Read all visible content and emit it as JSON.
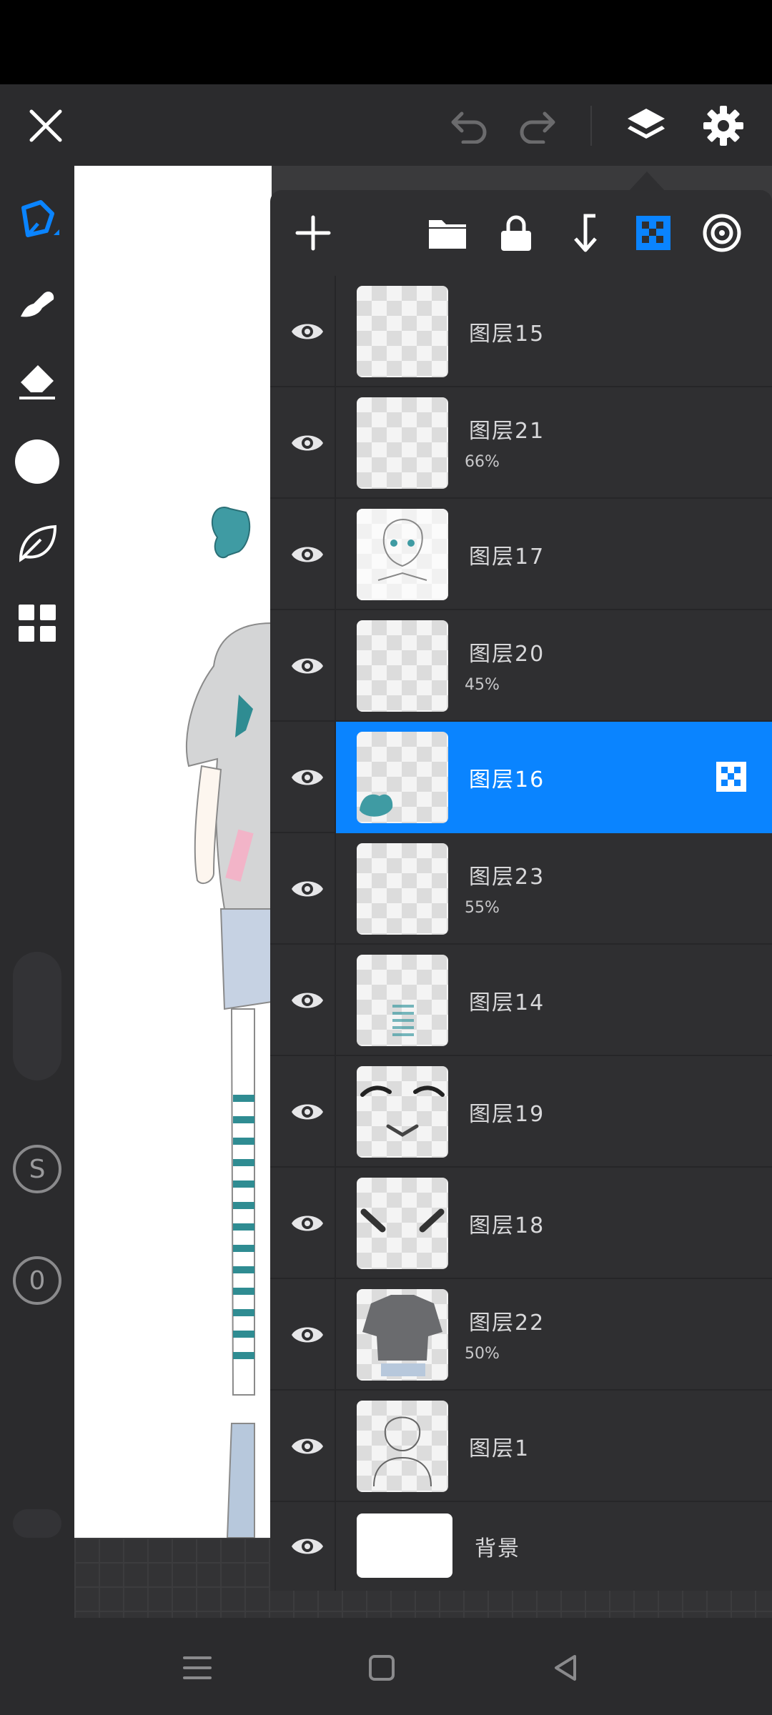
{
  "toolbar": {
    "close_icon": "close-icon",
    "undo_icon": "undo-icon",
    "redo_icon": "redo-icon",
    "layers_icon": "layers-icon",
    "settings_icon": "gear-icon"
  },
  "left_tools": [
    {
      "name": "pen-tool-icon",
      "active": true
    },
    {
      "name": "brush-tool-icon",
      "active": false
    },
    {
      "name": "eraser-tool-icon",
      "active": false
    },
    {
      "name": "color-swatch",
      "active": false
    },
    {
      "name": "leaf-tool-icon",
      "active": false
    },
    {
      "name": "grid-tool-icon",
      "active": false
    }
  ],
  "side_buttons": {
    "s_label": "S",
    "zero_label": "0"
  },
  "layer_panel": {
    "actions": [
      "add-layer-icon",
      "folder-icon",
      "lock-icon",
      "merge-down-icon",
      "alpha-lock-icon",
      "blend-icon"
    ],
    "accent_color": "#0a84ff",
    "layers": [
      {
        "name": "图层15",
        "opacity": "",
        "selected": false,
        "visible": true
      },
      {
        "name": "图层21",
        "opacity": "66%",
        "selected": false,
        "visible": true
      },
      {
        "name": "图层17",
        "opacity": "",
        "selected": false,
        "visible": true
      },
      {
        "name": "图层20",
        "opacity": "45%",
        "selected": false,
        "visible": true
      },
      {
        "name": "图层16",
        "opacity": "",
        "selected": true,
        "visible": true
      },
      {
        "name": "图层23",
        "opacity": "55%",
        "selected": false,
        "visible": true
      },
      {
        "name": "图层14",
        "opacity": "",
        "selected": false,
        "visible": true
      },
      {
        "name": "图层19",
        "opacity": "",
        "selected": false,
        "visible": true
      },
      {
        "name": "图层18",
        "opacity": "",
        "selected": false,
        "visible": true
      },
      {
        "name": "图层22",
        "opacity": "50%",
        "selected": false,
        "visible": true
      },
      {
        "name": "图层1",
        "opacity": "",
        "selected": false,
        "visible": true
      },
      {
        "name": "背景",
        "opacity": "",
        "selected": false,
        "visible": true
      }
    ]
  },
  "navbar": [
    "menu-icon",
    "home-icon",
    "back-icon"
  ]
}
